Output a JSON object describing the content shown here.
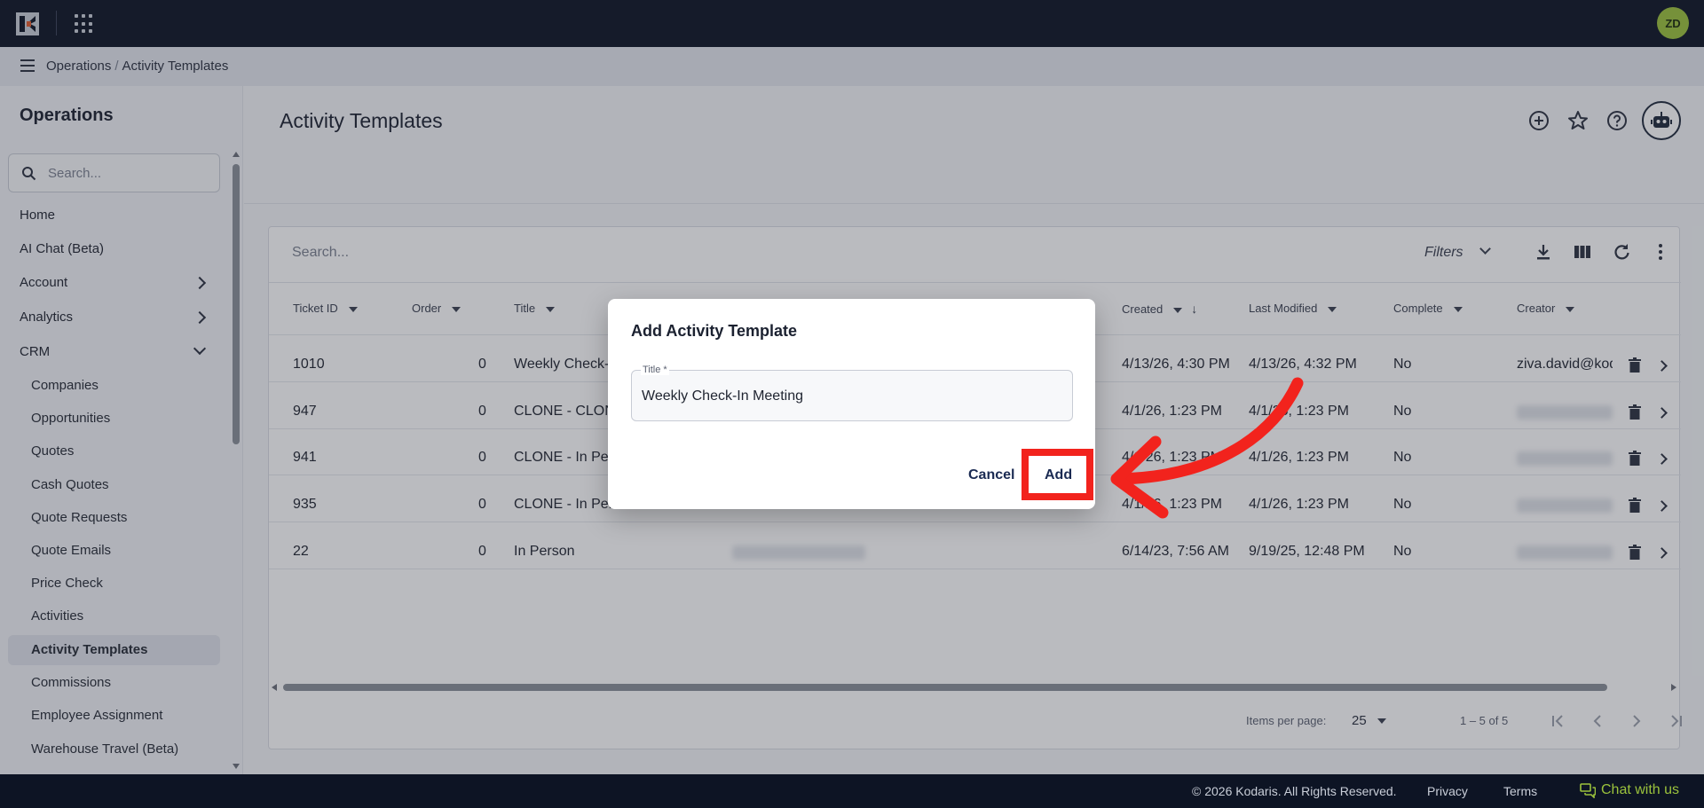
{
  "header": {
    "avatar_initials": "ZD"
  },
  "breadcrumb": {
    "section": "Operations",
    "separator": "/",
    "page": "Activity Templates"
  },
  "sidebar": {
    "title": "Operations",
    "search_placeholder": "Search...",
    "items": [
      {
        "label": "Home"
      },
      {
        "label": "AI Chat (Beta)"
      },
      {
        "label": "Account"
      },
      {
        "label": "Analytics"
      },
      {
        "label": "CRM"
      }
    ],
    "crm_items": [
      {
        "label": "Companies"
      },
      {
        "label": "Opportunities"
      },
      {
        "label": "Quotes"
      },
      {
        "label": "Cash Quotes"
      },
      {
        "label": "Quote Requests"
      },
      {
        "label": "Quote Emails"
      },
      {
        "label": "Price Check"
      },
      {
        "label": "Activities"
      },
      {
        "label": "Activity Templates"
      },
      {
        "label": "Commissions"
      },
      {
        "label": "Employee Assignment"
      },
      {
        "label": "Warehouse Travel (Beta)"
      }
    ]
  },
  "main": {
    "title": "Activity Templates"
  },
  "grid": {
    "search_placeholder": "Search...",
    "filters_label": "Filters",
    "columns": {
      "ticket_id": "Ticket ID",
      "order": "Order",
      "title": "Title",
      "created": "Created",
      "last_modified": "Last Modified",
      "complete": "Complete",
      "creator": "Creator"
    },
    "rows": [
      {
        "ticket_id": "1010",
        "order": "0",
        "title": "Weekly Check-",
        "created": "4/13/26, 4:30 PM",
        "last_modified": "4/13/26, 4:32 PM",
        "complete": "No",
        "creator": "ziva.david@kod"
      },
      {
        "ticket_id": "947",
        "order": "0",
        "title": "CLONE - CLON",
        "created": "4/1/26, 1:23 PM",
        "last_modified": "4/1/26, 1:23 PM",
        "complete": "No",
        "creator": ""
      },
      {
        "ticket_id": "941",
        "order": "0",
        "title": "CLONE - In Per",
        "created": "4/1/26, 1:23 PM",
        "last_modified": "4/1/26, 1:23 PM",
        "complete": "No",
        "creator": ""
      },
      {
        "ticket_id": "935",
        "order": "0",
        "title": "CLONE - In Per",
        "created": "4/1/26, 1:23 PM",
        "last_modified": "4/1/26, 1:23 PM",
        "complete": "No",
        "creator": ""
      },
      {
        "ticket_id": "22",
        "order": "0",
        "title": "In Person",
        "created": "6/14/23, 7:56 AM",
        "last_modified": "9/19/25, 12:48 PM",
        "complete": "No",
        "creator": ""
      }
    ],
    "items_per_page_label": "Items per page:",
    "items_per_page": "25",
    "range_label": "1 – 5 of 5"
  },
  "dialog": {
    "title": "Add Activity Template",
    "field_label": "Title *",
    "field_value": "Weekly Check-In Meeting",
    "cancel_label": "Cancel",
    "add_label": "Add"
  },
  "footer": {
    "copyright": "© 2026 Kodaris. All Rights Reserved.",
    "privacy": "Privacy",
    "terms": "Terms",
    "chat": "Chat with us"
  },
  "colors": {
    "accent": "#9bc23c",
    "highlight": "#f2231d",
    "nav_dark": "#0d1424"
  }
}
